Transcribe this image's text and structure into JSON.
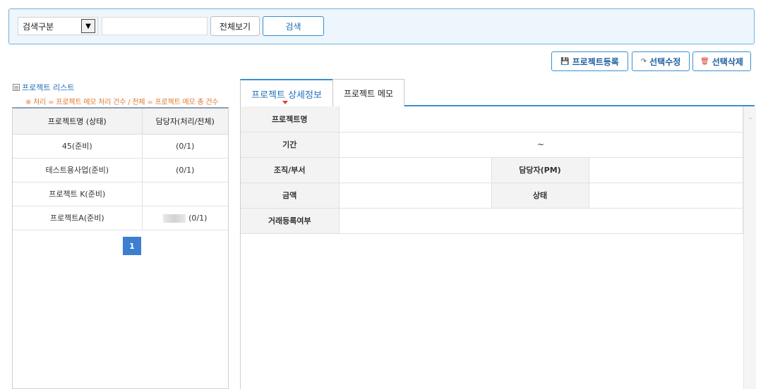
{
  "search": {
    "type_select": "검색구분",
    "query_value": "",
    "query_placeholder": "",
    "show_all_label": "전체보기",
    "search_label": "검색"
  },
  "actions": {
    "register_label": "프로젝트등록",
    "edit_label": "선택수정",
    "delete_label": "선택삭제"
  },
  "project_list": {
    "title": "프로젝트 리스트",
    "note": "※ 처리 = 프로젝트 메모 처리 건수 / 전체 = 프로젝트 메모 총 건수",
    "columns": [
      "프로젝트명 (상태)",
      "담당자(처리/전체)"
    ],
    "rows": [
      {
        "name": "45(준비)",
        "manager": "(0/1)"
      },
      {
        "name": "테스트용사업(준비)",
        "manager": "(0/1)"
      },
      {
        "name": "프로젝트 K(준비)",
        "manager": ""
      },
      {
        "name": "프로젝트A(준비)",
        "manager": "(0/1)"
      }
    ],
    "current_page": "1"
  },
  "tabs": [
    {
      "label": "프로젝트 상세정보",
      "active": true
    },
    {
      "label": "프로젝트 메모",
      "active": false
    }
  ],
  "detail": {
    "project_name_label": "프로젝트명",
    "project_name_value": "",
    "period_label": "기간",
    "period_value": "~",
    "org_label": "조직/부서",
    "org_value": "",
    "manager_label": "담당자(PM)",
    "manager_value": "",
    "amount_label": "금액",
    "amount_value": "",
    "status_label": "상태",
    "status_value": "",
    "trade_label": "거래등록여부",
    "trade_value": ""
  },
  "colors": {
    "accent": "#3a8fd2",
    "search_bar_bg": "#edf6fc",
    "note": "#e27a2f",
    "pager": "#3c7fd1",
    "delete_icon": "#d9342b"
  }
}
